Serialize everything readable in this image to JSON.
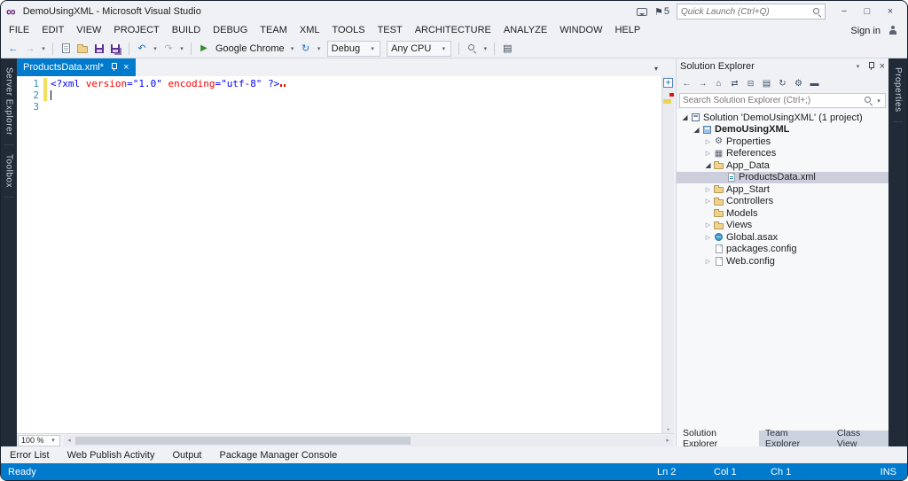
{
  "window": {
    "title": "DemoUsingXML - Microsoft Visual Studio"
  },
  "titlebar": {
    "notification_count": "5",
    "quick_launch_placeholder": "Quick Launch (Ctrl+Q)"
  },
  "menu": {
    "items": [
      "FILE",
      "EDIT",
      "VIEW",
      "PROJECT",
      "BUILD",
      "DEBUG",
      "TEAM",
      "XML",
      "TOOLS",
      "TEST",
      "ARCHITECTURE",
      "ANALYZE",
      "WINDOW",
      "HELP"
    ],
    "sign_in": "Sign in"
  },
  "toolbar": {
    "run_target": "Google Chrome",
    "configuration": "Debug",
    "platform": "Any CPU"
  },
  "left_panel_tabs": [
    {
      "label": "Server Explorer"
    },
    {
      "label": "Toolbox"
    }
  ],
  "right_panel_tabs": [
    {
      "label": "Properties"
    }
  ],
  "editor": {
    "active_tab": "ProductsData.xml*",
    "line_numbers": [
      "1",
      "2",
      "3"
    ],
    "tokens": [
      {
        "text": "<?xml ",
        "role": "xml-delimiter"
      },
      {
        "text": "version",
        "role": "xml-attribute"
      },
      {
        "text": "=\"1.0\" ",
        "role": "xml-value"
      },
      {
        "text": "encoding",
        "role": "xml-attribute"
      },
      {
        "text": "=\"utf-8\" ",
        "role": "xml-value"
      },
      {
        "text": "?>",
        "role": "xml-delimiter"
      }
    ],
    "zoom_level": "100 %"
  },
  "solution_explorer": {
    "title": "Solution Explorer",
    "search_placeholder": "Search Solution Explorer (Ctrl+;)",
    "tree": [
      {
        "label": "Solution 'DemoUsingXML' (1 project)"
      },
      {
        "label": "DemoUsingXML"
      },
      {
        "label": "Properties"
      },
      {
        "label": "References"
      },
      {
        "label": "App_Data"
      },
      {
        "label": "ProductsData.xml"
      },
      {
        "label": "App_Start"
      },
      {
        "label": "Controllers"
      },
      {
        "label": "Models"
      },
      {
        "label": "Views"
      },
      {
        "label": "Global.asax"
      },
      {
        "label": "packages.config"
      },
      {
        "label": "Web.config"
      }
    ],
    "bottom_tabs": [
      "Solution Explorer",
      "Team Explorer",
      "Class View"
    ]
  },
  "bottom_tabs": [
    "Error List",
    "Web Publish Activity",
    "Output",
    "Package Manager Console"
  ],
  "statusbar": {
    "state": "Ready",
    "line": "Ln 2",
    "column": "Col 1",
    "character": "Ch 1",
    "mode": "INS"
  },
  "icons": {
    "logo": "∞",
    "flag": "⚑",
    "minimize": "−",
    "maximize": "□",
    "close": "×",
    "back": "←",
    "forward": "→",
    "caret_down": "▾",
    "undo": "↶",
    "redo": "↷",
    "run": "▶",
    "refresh": "↻",
    "home": "⌂",
    "sync": "⇄",
    "collapse_all": "⊟",
    "show_all_files": "▤",
    "properties_gear": "⚙",
    "references": "▦",
    "preview": "▬",
    "expanded": "◢",
    "collapsed": "▷",
    "scroll_up": "▴",
    "scroll_down": "▾",
    "scroll_left": "◂",
    "scroll_right": "▸",
    "add": "+"
  },
  "colors": {
    "accent": "#007acc",
    "status_bar": "#007acc",
    "active_tab": "#007acc",
    "selection_inactive": "#cccedb",
    "line_number": "#2b91af",
    "xml_delimiter": "#0000ff",
    "xml_attribute": "#ff0000",
    "xml_value": "#0000ff",
    "modified_marker": "#f2e060",
    "error_marker": "#e51400"
  }
}
